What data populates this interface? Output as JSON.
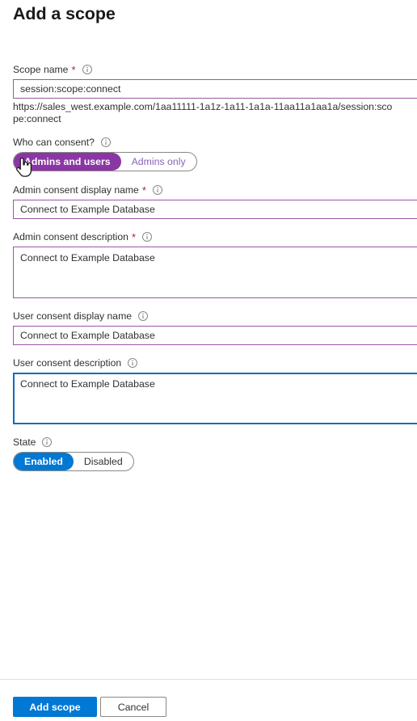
{
  "page": {
    "title": "Add a scope"
  },
  "fields": {
    "scope_name": {
      "label": "Scope name",
      "required": true,
      "value": "session:scope:connect",
      "helper_url": "https://sales_west.example.com/1aa11111-1a1z-1a11-1a1a-11aa11a1aa1a/session:scope:connect"
    },
    "who_can_consent": {
      "label": "Who can consent?",
      "required": false,
      "options": [
        "Admins and users",
        "Admins only"
      ],
      "selected": "Admins and users"
    },
    "admin_consent_display_name": {
      "label": "Admin consent display name",
      "required": true,
      "value": "Connect to Example Database"
    },
    "admin_consent_description": {
      "label": "Admin consent description",
      "required": true,
      "value": "Connect to Example Database"
    },
    "user_consent_display_name": {
      "label": "User consent display name",
      "required": false,
      "value": "Connect to Example Database"
    },
    "user_consent_description": {
      "label": "User consent description",
      "required": false,
      "value": "Connect to Example Database",
      "focused": true
    },
    "state": {
      "label": "State",
      "required": false,
      "options": [
        "Enabled",
        "Disabled"
      ],
      "selected": "Enabled"
    }
  },
  "footer": {
    "primary_label": "Add scope",
    "secondary_label": "Cancel"
  },
  "icons": {
    "info": "info-icon",
    "cursor": "hand-pointer-cursor"
  },
  "colors": {
    "accent_blue": "#0078d4",
    "focus_blue": "#0f6cbd",
    "purple_border": "#9b55a5",
    "purple_selected": "#8b36a5",
    "purple_text": "#8764b8",
    "required_red": "#a4262c",
    "divider": "#e1dfdd",
    "text": "#323130"
  }
}
